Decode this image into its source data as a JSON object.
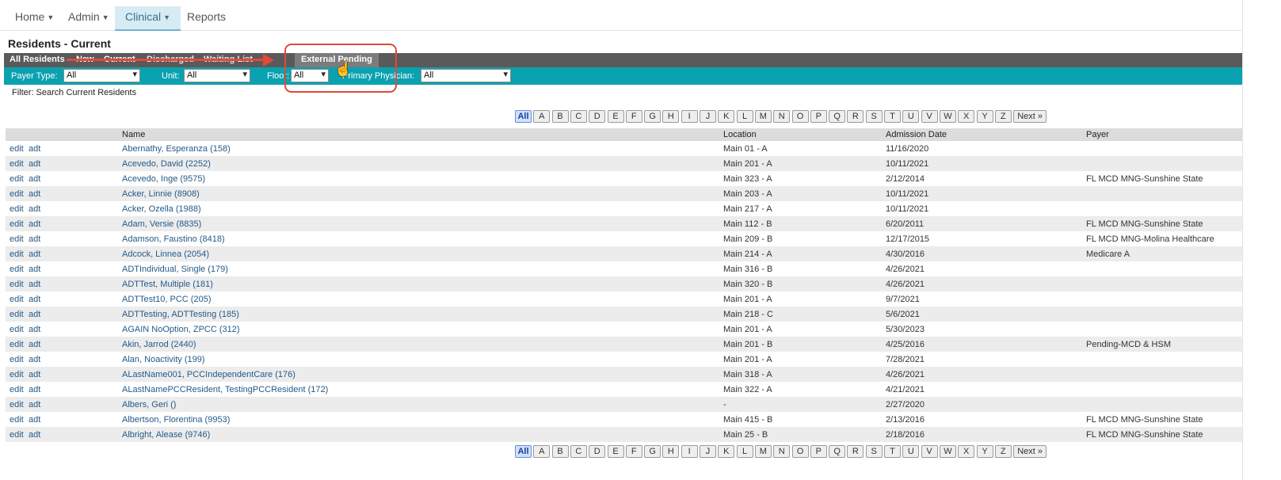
{
  "nav": [
    {
      "label": "Home",
      "caret": true
    },
    {
      "label": "Admin",
      "caret": true
    },
    {
      "label": "Clinical",
      "caret": true
    },
    {
      "label": "Reports",
      "caret": false
    }
  ],
  "page_title": "Residents - Current",
  "tabs": {
    "all": "All Residents",
    "new": "New",
    "current": "Current",
    "discharged": "Discharged",
    "waiting": "Waiting List",
    "external_pending": "External Pending"
  },
  "filters": {
    "payer_label": "Payer Type:",
    "payer_value": "All",
    "unit_label": "Unit:",
    "unit_value": "All",
    "floor_label": "Floor:",
    "floor_value": "All",
    "physician_label": "Primary Physician:",
    "physician_value": "All"
  },
  "filter_text": "Filter: Search Current Residents",
  "pager": [
    "All",
    "A",
    "B",
    "C",
    "D",
    "E",
    "F",
    "G",
    "H",
    "I",
    "J",
    "K",
    "L",
    "M",
    "N",
    "O",
    "P",
    "Q",
    "R",
    "S",
    "T",
    "U",
    "V",
    "W",
    "X",
    "Y",
    "Z",
    "Next »"
  ],
  "columns": {
    "name": "Name",
    "location": "Location",
    "admission": "Admission Date",
    "payer": "Payer"
  },
  "links": {
    "edit": "edit",
    "adt": "adt"
  },
  "rows": [
    {
      "name": "Abernathy, Esperanza (158)",
      "location": "Main 01 - A",
      "admission": "11/16/2020",
      "payer": ""
    },
    {
      "name": "Acevedo, David (2252)",
      "location": "Main 201 - A",
      "admission": "10/11/2021",
      "payer": ""
    },
    {
      "name": "Acevedo, Inge (9575)",
      "location": "Main 323 - A",
      "admission": "2/12/2014",
      "payer": "FL MCD MNG-Sunshine State"
    },
    {
      "name": "Acker, Linnie (8908)",
      "location": "Main 203 - A",
      "admission": "10/11/2021",
      "payer": ""
    },
    {
      "name": "Acker, Ozella (1988)",
      "location": "Main 217 - A",
      "admission": "10/11/2021",
      "payer": ""
    },
    {
      "name": "Adam, Versie (8835)",
      "location": "Main 112 - B",
      "admission": "6/20/2011",
      "payer": "FL MCD MNG-Sunshine State"
    },
    {
      "name": "Adamson, Faustino (8418)",
      "location": "Main 209 - B",
      "admission": "12/17/2015",
      "payer": "FL MCD MNG-Molina Healthcare"
    },
    {
      "name": "Adcock, Linnea (2054)",
      "location": "Main 214 - A",
      "admission": "4/30/2016",
      "payer": "Medicare A"
    },
    {
      "name": "ADTIndividual, Single (179)",
      "location": "Main 316 - B",
      "admission": "4/26/2021",
      "payer": ""
    },
    {
      "name": "ADTTest, Multiple (181)",
      "location": "Main 320 - B",
      "admission": "4/26/2021",
      "payer": ""
    },
    {
      "name": "ADTTest10, PCC (205)",
      "location": "Main 201 - A",
      "admission": "9/7/2021",
      "payer": ""
    },
    {
      "name": "ADTTesting, ADTTesting (185)",
      "location": "Main 218 - C",
      "admission": "5/6/2021",
      "payer": ""
    },
    {
      "name": "AGAIN NoOption, ZPCC (312)",
      "location": "Main 201 - A",
      "admission": "5/30/2023",
      "payer": ""
    },
    {
      "name": "Akin, Jarrod (2440)",
      "location": "Main 201 - B",
      "admission": "4/25/2016",
      "payer": "Pending-MCD & HSM"
    },
    {
      "name": "Alan, Noactivity (199)",
      "location": "Main 201 - A",
      "admission": "7/28/2021",
      "payer": ""
    },
    {
      "name": "ALastName001, PCCIndependentCare (176)",
      "location": "Main 318 - A",
      "admission": "4/26/2021",
      "payer": ""
    },
    {
      "name": "ALastNamePCCResident, TestingPCCResident (172)",
      "location": "Main 322 - A",
      "admission": "4/21/2021",
      "payer": ""
    },
    {
      "name": "Albers, Geri ()",
      "location": "-",
      "admission": "2/27/2020",
      "payer": ""
    },
    {
      "name": "Albertson, Florentina (9953)",
      "location": "Main 415 - B",
      "admission": "2/13/2016",
      "payer": "FL MCD MNG-Sunshine State"
    },
    {
      "name": "Albright, Alease (9746)",
      "location": "Main 25 - B",
      "admission": "2/18/2016",
      "payer": "FL MCD MNG-Sunshine State"
    }
  ]
}
